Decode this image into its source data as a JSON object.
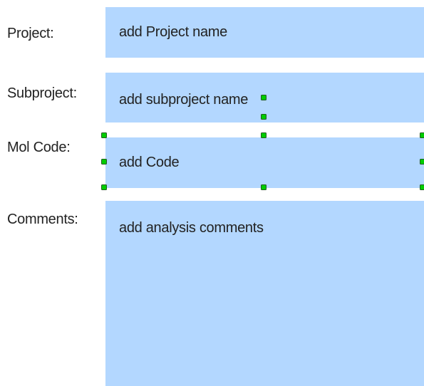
{
  "form": {
    "project": {
      "label": "Project:",
      "value": "add Project name"
    },
    "subproject": {
      "label": "Subproject:",
      "value": "add subproject name"
    },
    "mol_code": {
      "label": "Mol Code:",
      "value": "add Code"
    },
    "comments": {
      "label": "Comments:",
      "value": "add analysis comments"
    }
  },
  "colors": {
    "field_fill": "#b3d7ff",
    "selection_handle": "#00cc00",
    "text": "#222222"
  }
}
